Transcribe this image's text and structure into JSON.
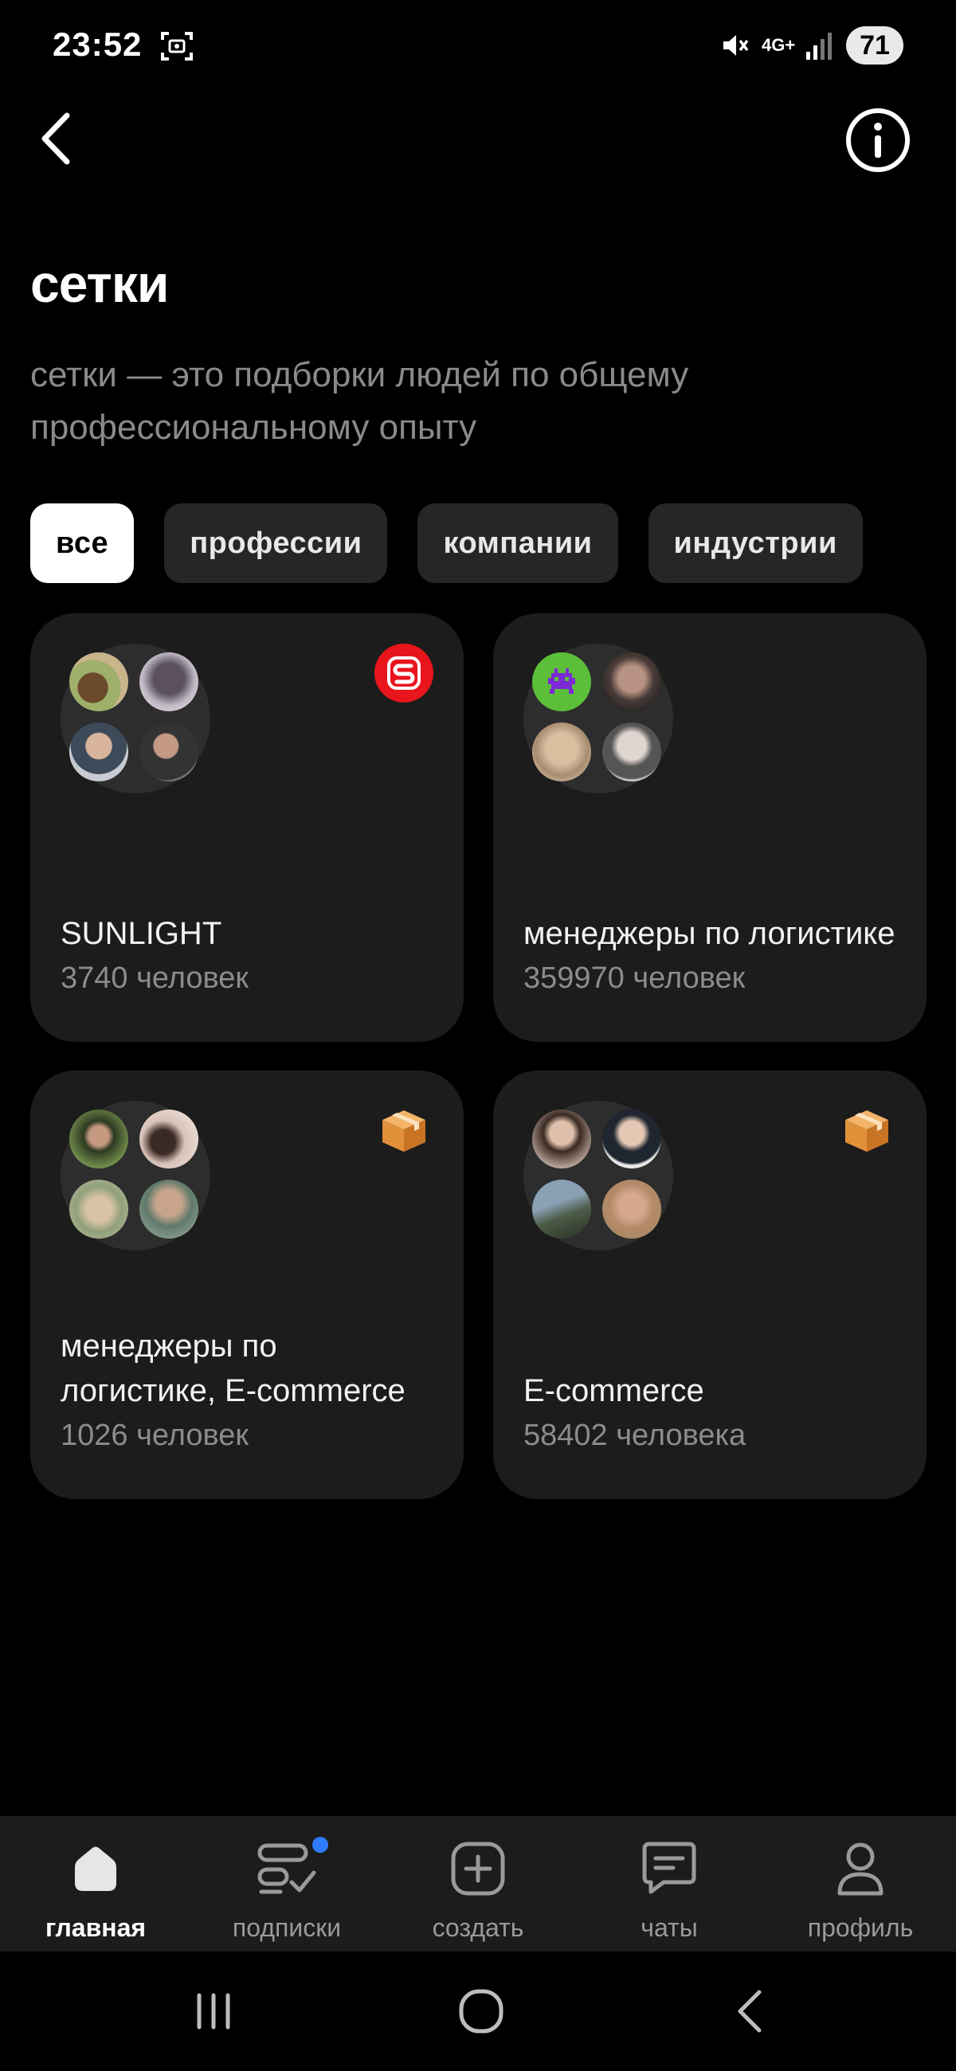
{
  "status_bar": {
    "time": "23:52",
    "network": "4G+",
    "battery": "71",
    "icons": [
      "screenshot-icon",
      "mute-icon",
      "signal-icon"
    ]
  },
  "header": {
    "back_icon": "chevron-left-icon",
    "info_icon": "info-icon"
  },
  "page": {
    "title": "сетки",
    "description": "сетки — это подборки людей по общему профессиональному опыту"
  },
  "filters": [
    {
      "label": "все",
      "active": true
    },
    {
      "label": "профессии",
      "active": false
    },
    {
      "label": "компании",
      "active": false
    },
    {
      "label": "индустрии",
      "active": false
    }
  ],
  "cards": [
    {
      "title": "SUNLIGHT",
      "count": "3740 человек",
      "badge": "sunlight-logo-icon"
    },
    {
      "title": "менеджеры по логистике",
      "count": "359970 человек",
      "badge": ""
    },
    {
      "title": "менеджеры по логистике, E-commerce",
      "count": "1026 человек",
      "badge": "package-icon"
    },
    {
      "title": "E-commerce",
      "count": "58402 человека",
      "badge": "package-icon"
    }
  ],
  "bottom_nav": [
    {
      "label": "главная",
      "icon": "home-icon",
      "active": true
    },
    {
      "label": "подписки",
      "icon": "subscriptions-icon",
      "active": false,
      "has_dot": true
    },
    {
      "label": "создать",
      "icon": "plus-square-icon",
      "active": false
    },
    {
      "label": "чаты",
      "icon": "chat-icon",
      "active": false
    },
    {
      "label": "профиль",
      "icon": "profile-icon",
      "active": false
    }
  ],
  "colors": {
    "background": "#000000",
    "card": "#1c1c1c",
    "chip": "#262626",
    "accent_dot": "#2f7bff",
    "sunlight_red": "#e8151d"
  }
}
